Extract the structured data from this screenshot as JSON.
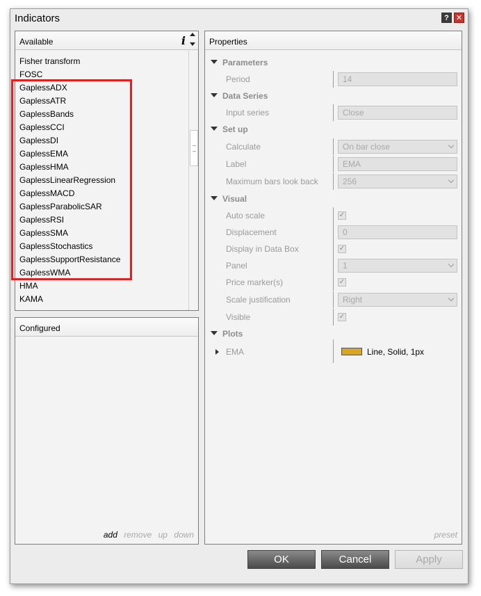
{
  "window": {
    "title": "Indicators",
    "help_glyph": "?",
    "close_glyph": "✕"
  },
  "available": {
    "header": "Available",
    "info_glyph": "i",
    "items": [
      "Fisher transform",
      "FOSC",
      "GaplessADX",
      "GaplessATR",
      "GaplessBands",
      "GaplessCCI",
      "GaplessDI",
      "GaplessEMA",
      "GaplessHMA",
      "GaplessLinearRegression",
      "GaplessMACD",
      "GaplessParabolicSAR",
      "GaplessRSI",
      "GaplessSMA",
      "GaplessStochastics",
      "GaplessSupportResistance",
      "GaplessWMA",
      "HMA",
      "KAMA"
    ]
  },
  "configured": {
    "header": "Configured",
    "add": "add",
    "remove": "remove",
    "up": "up",
    "down": "down"
  },
  "properties": {
    "header": "Properties",
    "preset": "preset",
    "parameters": {
      "label": "Parameters",
      "period_label": "Period",
      "period_value": "14"
    },
    "data_series": {
      "label": "Data Series",
      "input_series_label": "Input series",
      "input_series_value": "Close"
    },
    "setup": {
      "label": "Set up",
      "calculate_label": "Calculate",
      "calculate_value": "On bar close",
      "label_label": "Label",
      "label_value": "EMA",
      "max_bars_label": "Maximum bars look back",
      "max_bars_value": "256"
    },
    "visual": {
      "label": "Visual",
      "auto_scale_label": "Auto scale",
      "displacement_label": "Displacement",
      "displacement_value": "0",
      "display_in_data_box_label": "Display in Data Box",
      "panel_label": "Panel",
      "panel_value": "1",
      "price_markers_label": "Price marker(s)",
      "scale_justification_label": "Scale justification",
      "scale_justification_value": "Right",
      "visible_label": "Visible",
      "check_glyph": "✓"
    },
    "plots": {
      "label": "Plots",
      "ema_label": "EMA",
      "ema_value": "Line, Solid, 1px",
      "ema_color": "#daa520"
    }
  },
  "buttons": {
    "ok": "OK",
    "cancel": "Cancel",
    "apply": "Apply"
  }
}
